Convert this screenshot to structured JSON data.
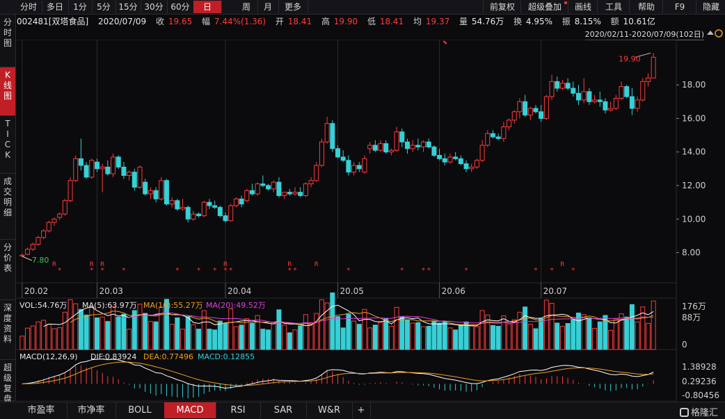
{
  "toolbar": {
    "periods": [
      "分时",
      "多日",
      "1分",
      "5分",
      "15分",
      "30分",
      "60分",
      "日",
      "周",
      "月",
      "更多"
    ],
    "active_period": "日",
    "tools": [
      "前复权",
      "超级叠加",
      "画线",
      "工具",
      "帮助",
      "F9",
      "隐藏"
    ]
  },
  "left_nav": [
    "分时图",
    "K线图",
    "TICK",
    "成交明细",
    "分价表",
    "深度资料",
    "超级复盘"
  ],
  "left_nav_active": "K线图",
  "info": {
    "code_name": "002481[双塔食品]",
    "date": "2020/07/09",
    "close_label": "收",
    "close": "19.65",
    "change_label": "幅",
    "change": "7.44%(1.36)",
    "open_label": "开",
    "open": "18.41",
    "high_label": "高",
    "high": "19.90",
    "low_label": "低",
    "low": "18.41",
    "avg_label": "均",
    "avg": "19.37",
    "volume_label": "量",
    "volume": "54.76万",
    "turnover_label": "换",
    "turnover": "4.95%",
    "amplitude_label": "振",
    "amplitude": "8.15%",
    "amount_label": "额",
    "amount": "10.61亿"
  },
  "date_range": "2020/02/11-2020/07/09(102日)",
  "vol_panel": {
    "vol_label": "VOL:54.76万",
    "ma5_label": "MA(5):63.97万",
    "ma10_label": "MA(10):55.27万",
    "ma20_label": "MA(20):49.52万",
    "axis": [
      "176万",
      "88万",
      "0"
    ]
  },
  "macd_panel": {
    "title": "MACD(12,26,9)",
    "dif_label": "DIF:0.83924",
    "dea_label": "DEA:0.77496",
    "macd_label": "MACD:0.12855",
    "axis": [
      "1.38928",
      "0.29236",
      "-0.80456"
    ]
  },
  "bottom_tabs": [
    "市盈率",
    "市净率",
    "BOLL",
    "MACD",
    "RSI",
    "SAR",
    "W&R",
    "+"
  ],
  "bottom_active": "MACD",
  "logo": "格隆汇",
  "colors": {
    "up": "#ff3b3b",
    "down": "#36d0d6",
    "ma5": "#ffffff",
    "ma10": "#f0a020",
    "ma20": "#e040e0",
    "active_tab": "#c01f25"
  },
  "chart_data": {
    "type": "candlestick",
    "y_ticks": [
      8,
      10,
      12,
      14,
      16,
      18
    ],
    "x_ticks": [
      "20.02",
      "20.03",
      "20.04",
      "20.05",
      "20.06",
      "20.07"
    ],
    "x_tick_index": [
      0,
      14,
      38,
      59,
      78,
      97
    ],
    "high_label": "19.90",
    "low_label": "7.80",
    "ohlc": [
      [
        7.8,
        7.95,
        7.78,
        7.85
      ],
      [
        7.9,
        8.3,
        7.85,
        8.2
      ],
      [
        8.2,
        8.6,
        8.1,
        8.5
      ],
      [
        8.5,
        9.0,
        8.4,
        8.9
      ],
      [
        8.9,
        9.4,
        8.8,
        9.3
      ],
      [
        9.3,
        9.9,
        9.2,
        9.8
      ],
      [
        9.8,
        10.1,
        9.6,
        10.0
      ],
      [
        10.1,
        10.4,
        9.95,
        10.3
      ],
      [
        10.3,
        11.2,
        10.2,
        11.1
      ],
      [
        11.1,
        12.5,
        11.0,
        12.3
      ],
      [
        12.3,
        13.8,
        12.2,
        13.6
      ],
      [
        13.6,
        14.8,
        12.9,
        13.2
      ],
      [
        13.2,
        13.4,
        12.4,
        12.5
      ],
      [
        12.5,
        13.6,
        12.4,
        13.5
      ],
      [
        13.4,
        13.6,
        12.8,
        13.0
      ],
      [
        13.0,
        13.3,
        11.6,
        13.1
      ],
      [
        13.1,
        13.5,
        12.6,
        12.7
      ],
      [
        12.7,
        13.9,
        12.5,
        13.7
      ],
      [
        13.7,
        13.8,
        13.0,
        13.1
      ],
      [
        13.1,
        13.4,
        12.4,
        12.6
      ],
      [
        12.6,
        12.9,
        12.3,
        12.8
      ],
      [
        12.8,
        13.0,
        11.7,
        11.9
      ],
      [
        11.9,
        13.2,
        11.8,
        13.1
      ],
      [
        12.2,
        12.4,
        11.4,
        11.5
      ],
      [
        11.5,
        11.9,
        11.2,
        11.7
      ],
      [
        11.7,
        11.9,
        11.0,
        11.2
      ],
      [
        11.2,
        12.5,
        11.1,
        12.3
      ],
      [
        12.3,
        12.4,
        10.8,
        10.9
      ],
      [
        10.9,
        11.3,
        10.7,
        11.1
      ],
      [
        11.1,
        11.2,
        10.5,
        10.6
      ],
      [
        10.6,
        11.2,
        10.5,
        10.7
      ],
      [
        10.7,
        10.8,
        9.8,
        10.0
      ],
      [
        10.0,
        10.5,
        9.9,
        10.3
      ],
      [
        10.3,
        10.4,
        10.1,
        10.2
      ],
      [
        10.2,
        11.1,
        10.1,
        11.0
      ],
      [
        11.0,
        11.2,
        10.6,
        10.8
      ],
      [
        10.8,
        11.1,
        10.6,
        10.7
      ],
      [
        10.7,
        10.8,
        10.1,
        10.2
      ],
      [
        10.2,
        10.4,
        9.8,
        9.9
      ],
      [
        9.9,
        10.9,
        9.85,
        10.8
      ],
      [
        10.8,
        11.3,
        10.7,
        11.2
      ],
      [
        11.2,
        11.4,
        10.7,
        10.9
      ],
      [
        11.1,
        11.8,
        11.0,
        11.7
      ],
      [
        11.7,
        12.1,
        11.4,
        11.5
      ],
      [
        11.5,
        12.2,
        11.4,
        12.1
      ],
      [
        12.1,
        12.6,
        11.9,
        12.0
      ],
      [
        12.0,
        12.1,
        11.7,
        11.8
      ],
      [
        11.8,
        12.3,
        11.6,
        12.2
      ],
      [
        12.2,
        12.5,
        11.3,
        11.4
      ],
      [
        11.4,
        11.6,
        11.2,
        11.6
      ],
      [
        11.6,
        11.8,
        11.4,
        11.5
      ],
      [
        11.5,
        11.9,
        11.4,
        11.6
      ],
      [
        11.6,
        11.9,
        11.3,
        11.4
      ],
      [
        11.4,
        12.2,
        11.3,
        12.1
      ],
      [
        12.1,
        12.5,
        11.9,
        12.3
      ],
      [
        12.3,
        13.4,
        12.2,
        13.2
      ],
      [
        13.2,
        14.8,
        13.1,
        14.6
      ],
      [
        14.6,
        16.1,
        14.5,
        15.7
      ],
      [
        15.7,
        15.9,
        14.0,
        14.2
      ],
      [
        14.2,
        14.4,
        13.6,
        13.7
      ],
      [
        13.7,
        14.1,
        13.4,
        13.5
      ],
      [
        13.5,
        13.8,
        12.6,
        12.8
      ],
      [
        12.8,
        13.4,
        12.6,
        13.2
      ],
      [
        13.2,
        13.4,
        12.8,
        13.0
      ],
      [
        12.8,
        13.8,
        12.7,
        13.6
      ],
      [
        14.2,
        14.6,
        13.9,
        14.4
      ],
      [
        14.4,
        14.7,
        14.0,
        14.1
      ],
      [
        14.1,
        14.7,
        14.0,
        14.5
      ],
      [
        14.5,
        14.7,
        13.9,
        14.0
      ],
      [
        14.0,
        14.2,
        13.8,
        14.1
      ],
      [
        14.1,
        15.5,
        14.0,
        15.2
      ],
      [
        15.2,
        15.4,
        14.3,
        14.6
      ],
      [
        14.6,
        14.8,
        13.9,
        14.2
      ],
      [
        14.2,
        14.7,
        14.0,
        14.4
      ],
      [
        14.4,
        14.8,
        14.1,
        14.3
      ],
      [
        14.3,
        14.7,
        14.0,
        14.6
      ],
      [
        14.6,
        14.8,
        14.2,
        14.3
      ],
      [
        14.3,
        14.4,
        13.7,
        13.8
      ],
      [
        13.8,
        14.2,
        13.5,
        13.6
      ],
      [
        13.6,
        13.9,
        13.2,
        13.4
      ],
      [
        13.4,
        13.9,
        13.3,
        13.7
      ],
      [
        13.7,
        14.0,
        13.5,
        13.6
      ],
      [
        13.6,
        13.8,
        13.2,
        13.3
      ],
      [
        13.3,
        13.5,
        12.8,
        13.0
      ],
      [
        13.0,
        13.3,
        12.8,
        13.1
      ],
      [
        13.1,
        13.6,
        13.0,
        13.5
      ],
      [
        13.5,
        14.7,
        13.4,
        14.4
      ],
      [
        14.4,
        15.3,
        14.3,
        15.1
      ],
      [
        15.1,
        15.3,
        14.8,
        14.9
      ],
      [
        14.9,
        15.1,
        14.7,
        14.8
      ],
      [
        14.8,
        15.8,
        14.6,
        15.5
      ],
      [
        15.5,
        16.0,
        15.3,
        15.9
      ],
      [
        15.9,
        16.5,
        15.7,
        16.4
      ],
      [
        16.4,
        17.2,
        16.0,
        17.0
      ],
      [
        17.0,
        17.4,
        16.1,
        16.2
      ],
      [
        16.2,
        16.7,
        15.9,
        16.6
      ],
      [
        16.6,
        16.8,
        16.3,
        16.4
      ],
      [
        16.4,
        16.8,
        15.8,
        16.0
      ],
      [
        16.0,
        17.4,
        15.9,
        17.3
      ],
      [
        17.3,
        18.6,
        17.1,
        18.2
      ],
      [
        18.2,
        18.5,
        17.6,
        17.8
      ],
      [
        17.8,
        18.3,
        17.7,
        18.1
      ],
      [
        18.1,
        18.4,
        17.7,
        17.8
      ],
      [
        17.8,
        18.2,
        17.3,
        17.5
      ],
      [
        17.5,
        18.0,
        16.8,
        17.1
      ],
      [
        17.1,
        18.4,
        16.9,
        17.6
      ],
      [
        17.6,
        17.8,
        16.8,
        17.0
      ],
      [
        17.0,
        17.4,
        16.9,
        17.1
      ],
      [
        17.1,
        17.6,
        16.7,
        17.0
      ],
      [
        17.0,
        17.2,
        16.3,
        16.5
      ],
      [
        16.5,
        17.0,
        16.4,
        16.6
      ],
      [
        16.6,
        17.4,
        16.5,
        17.2
      ],
      [
        17.2,
        18.2,
        17.1,
        17.9
      ],
      [
        17.9,
        18.0,
        17.2,
        17.3
      ],
      [
        17.3,
        17.8,
        16.2,
        16.6
      ],
      [
        16.6,
        17.3,
        16.4,
        17.1
      ],
      [
        17.1,
        18.4,
        17.0,
        18.2
      ],
      [
        18.2,
        18.7,
        17.9,
        18.41
      ],
      [
        18.41,
        19.9,
        18.41,
        19.65
      ]
    ],
    "volume_axis_max": 176,
    "volume_unit": "万",
    "macd_axis": [
      1.38928,
      0.29236,
      -0.80456
    ]
  }
}
